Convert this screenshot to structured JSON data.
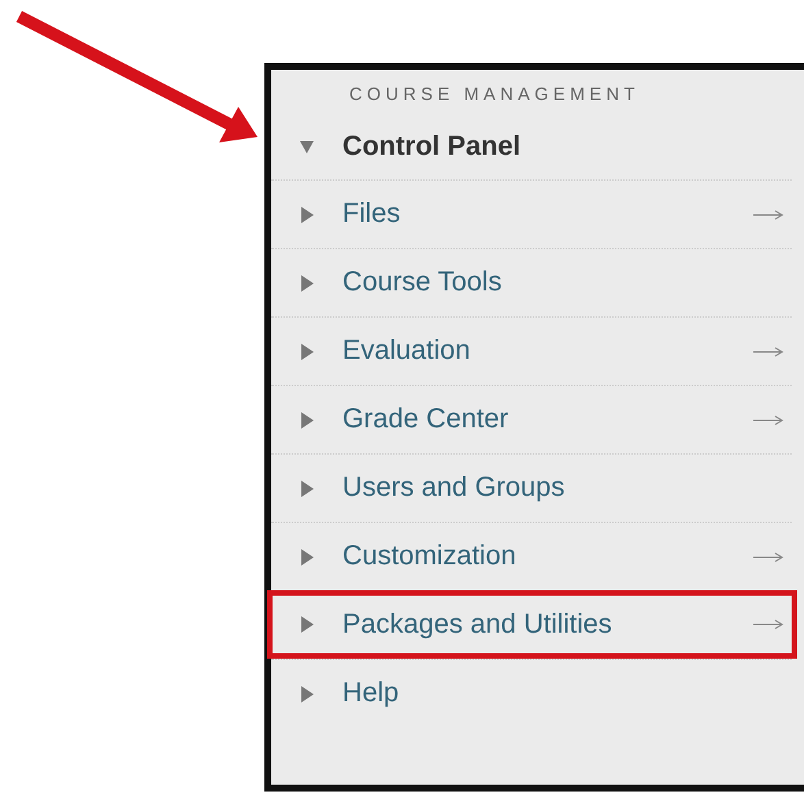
{
  "menu": {
    "heading": "COURSE MANAGEMENT",
    "section": {
      "label": "Control Panel",
      "expanded": true
    },
    "items": [
      {
        "label": "Files",
        "arrow": true,
        "highlighted": false
      },
      {
        "label": "Course Tools",
        "arrow": false,
        "highlighted": false
      },
      {
        "label": "Evaluation",
        "arrow": true,
        "highlighted": false
      },
      {
        "label": "Grade Center",
        "arrow": true,
        "highlighted": false
      },
      {
        "label": "Users and Groups",
        "arrow": false,
        "highlighted": false
      },
      {
        "label": "Customization",
        "arrow": true,
        "highlighted": false
      },
      {
        "label": "Packages and Utilities",
        "arrow": true,
        "highlighted": true
      },
      {
        "label": "Help",
        "arrow": false,
        "highlighted": false
      }
    ]
  }
}
